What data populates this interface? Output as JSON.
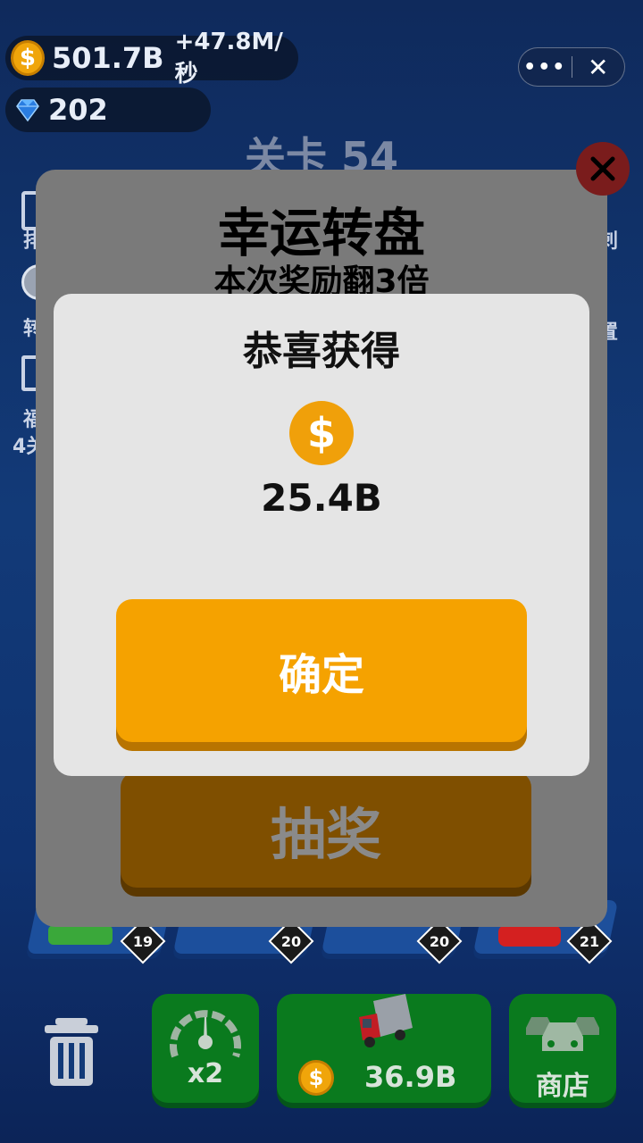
{
  "hud": {
    "coins": "501.7B",
    "rate": "+47.8M/秒",
    "gems": "202"
  },
  "level": {
    "label": "关卡 54"
  },
  "side": {
    "left_labels": [
      "排",
      "转",
      "福",
      "4关"
    ],
    "right_labels": [
      "刺",
      "置"
    ]
  },
  "board": {
    "badges": [
      "19",
      "20",
      "20",
      "21"
    ]
  },
  "wheel": {
    "title": "幸运转盘",
    "subtitle": "本次奖励翻3倍",
    "draw_label": "抽奖"
  },
  "dialog": {
    "title": "恭喜获得",
    "amount": "25.4B",
    "confirm_label": "确定"
  },
  "bottom": {
    "speed_label": "x2",
    "buy_price": "36.9B",
    "shop_label": "商店"
  },
  "colors": {
    "accent": "#f5a200",
    "green": "#0a7a1e",
    "panel": "#e5e5e5"
  }
}
